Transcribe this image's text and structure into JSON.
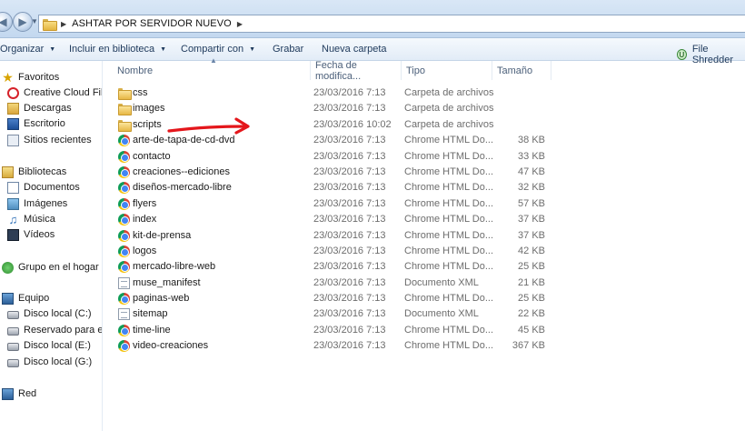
{
  "address": {
    "breadcrumb": [
      "ASHTAR POR SERVIDOR NUEVO"
    ]
  },
  "toolbar": {
    "organize": "Organizar",
    "include_library": "Incluir en biblioteca",
    "share_with": "Compartir con",
    "burn": "Grabar",
    "new_folder": "Nueva carpeta",
    "file_shredder": "File Shredder"
  },
  "sidebar": {
    "favorites": {
      "label": "Favoritos",
      "items": [
        {
          "label": "Creative Cloud Files",
          "icon": "creative-cloud-icon"
        },
        {
          "label": "Descargas",
          "icon": "downloads-icon"
        },
        {
          "label": "Escritorio",
          "icon": "desktop-icon"
        },
        {
          "label": "Sitios recientes",
          "icon": "recent-places-icon"
        }
      ]
    },
    "libraries": {
      "label": "Bibliotecas",
      "items": [
        {
          "label": "Documentos",
          "icon": "documents-icon"
        },
        {
          "label": "Imágenes",
          "icon": "pictures-icon"
        },
        {
          "label": "Música",
          "icon": "music-icon"
        },
        {
          "label": "Vídeos",
          "icon": "videos-icon"
        }
      ]
    },
    "homegroup": {
      "label": "Grupo en el hogar"
    },
    "computer": {
      "label": "Equipo",
      "items": [
        {
          "label": "Disco local (C:)"
        },
        {
          "label": "Reservado para el sis"
        },
        {
          "label": "Disco local (E:)"
        },
        {
          "label": "Disco local (G:)"
        }
      ]
    },
    "network": {
      "label": "Red"
    }
  },
  "columns": {
    "name": "Nombre",
    "date": "Fecha de modifica...",
    "type": "Tipo",
    "size": "Tamaño"
  },
  "files": [
    {
      "name": "css",
      "date": "23/03/2016 7:13",
      "type": "Carpeta de archivos",
      "size": "",
      "icon": "folder"
    },
    {
      "name": "images",
      "date": "23/03/2016 7:13",
      "type": "Carpeta de archivos",
      "size": "",
      "icon": "folder"
    },
    {
      "name": "scripts",
      "date": "23/03/2016 10:02",
      "type": "Carpeta de archivos",
      "size": "",
      "icon": "folder"
    },
    {
      "name": "arte-de-tapa-de-cd-dvd",
      "date": "23/03/2016 7:13",
      "type": "Chrome HTML Do...",
      "size": "38 KB",
      "icon": "chrome"
    },
    {
      "name": "contacto",
      "date": "23/03/2016 7:13",
      "type": "Chrome HTML Do...",
      "size": "33 KB",
      "icon": "chrome"
    },
    {
      "name": "creaciones--ediciones",
      "date": "23/03/2016 7:13",
      "type": "Chrome HTML Do...",
      "size": "47 KB",
      "icon": "chrome"
    },
    {
      "name": "diseños-mercado-libre",
      "date": "23/03/2016 7:13",
      "type": "Chrome HTML Do...",
      "size": "32 KB",
      "icon": "chrome"
    },
    {
      "name": "flyers",
      "date": "23/03/2016 7:13",
      "type": "Chrome HTML Do...",
      "size": "57 KB",
      "icon": "chrome"
    },
    {
      "name": "index",
      "date": "23/03/2016 7:13",
      "type": "Chrome HTML Do...",
      "size": "37 KB",
      "icon": "chrome"
    },
    {
      "name": "kit-de-prensa",
      "date": "23/03/2016 7:13",
      "type": "Chrome HTML Do...",
      "size": "37 KB",
      "icon": "chrome"
    },
    {
      "name": "logos",
      "date": "23/03/2016 7:13",
      "type": "Chrome HTML Do...",
      "size": "42 KB",
      "icon": "chrome"
    },
    {
      "name": "mercado-libre-web",
      "date": "23/03/2016 7:13",
      "type": "Chrome HTML Do...",
      "size": "25 KB",
      "icon": "chrome"
    },
    {
      "name": "muse_manifest",
      "date": "23/03/2016 7:13",
      "type": "Documento XML",
      "size": "21 KB",
      "icon": "xml"
    },
    {
      "name": "paginas-web",
      "date": "23/03/2016 7:13",
      "type": "Chrome HTML Do...",
      "size": "25 KB",
      "icon": "chrome"
    },
    {
      "name": "sitemap",
      "date": "23/03/2016 7:13",
      "type": "Documento XML",
      "size": "22 KB",
      "icon": "xml"
    },
    {
      "name": "time-line",
      "date": "23/03/2016 7:13",
      "type": "Chrome HTML Do...",
      "size": "45 KB",
      "icon": "chrome"
    },
    {
      "name": "video-creaciones",
      "date": "23/03/2016 7:13",
      "type": "Chrome HTML Do...",
      "size": "367 KB",
      "icon": "chrome"
    }
  ],
  "annotation": {
    "color": "#e4161b",
    "icon": "red-arrow-annotation"
  }
}
